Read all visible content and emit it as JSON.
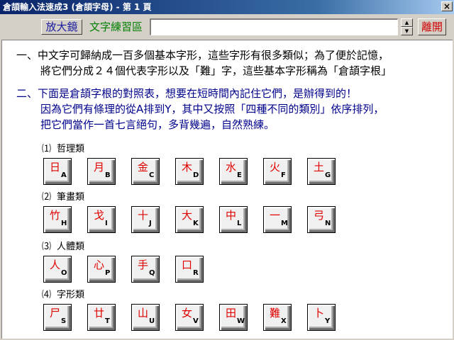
{
  "window": {
    "title": "倉頡輸入法速成3 (倉頡字母) - 第 1 頁",
    "close_label": "×"
  },
  "toolbar": {
    "magnifier_label": "放大鏡",
    "practice_label": "文字練習區",
    "practice_value": "",
    "spin_up": "▲",
    "spin_down": "▼",
    "exit_label": "離開"
  },
  "text": {
    "p1_line1": "一、中文字可歸納成一百多個基本字形，這些字形有很多類似；為了便於記憶，",
    "p1_line2": "將它們分成２４個代表字形以及「難」字，這些基本字形稱為「倉頡字根」",
    "p2_line1": "二、下面是倉頡字根的對照表，想要在短時間內記住它們，是辦得到的！",
    "p2_line2": "因為它們有條理的從A排到Y，其中又按照「四種不同的類別」依序排列，",
    "p2_line3": "把它們當作一首七言絕句，多背幾遍，自然熟練。"
  },
  "groups": [
    {
      "num": "⑴",
      "label": "哲理類",
      "keys": [
        {
          "char": "日",
          "letter": "A"
        },
        {
          "char": "月",
          "letter": "B"
        },
        {
          "char": "金",
          "letter": "C"
        },
        {
          "char": "木",
          "letter": "D"
        },
        {
          "char": "水",
          "letter": "E"
        },
        {
          "char": "火",
          "letter": "F"
        },
        {
          "char": "土",
          "letter": "G"
        }
      ]
    },
    {
      "num": "⑵",
      "label": "筆畫類",
      "keys": [
        {
          "char": "竹",
          "letter": "H"
        },
        {
          "char": "戈",
          "letter": "I"
        },
        {
          "char": "十",
          "letter": "J"
        },
        {
          "char": "大",
          "letter": "K"
        },
        {
          "char": "中",
          "letter": "L"
        },
        {
          "char": "一",
          "letter": "M"
        },
        {
          "char": "弓",
          "letter": "N"
        }
      ]
    },
    {
      "num": "⑶",
      "label": "人體類",
      "keys": [
        {
          "char": "人",
          "letter": "O"
        },
        {
          "char": "心",
          "letter": "P"
        },
        {
          "char": "手",
          "letter": "Q"
        },
        {
          "char": "口",
          "letter": "R"
        }
      ]
    },
    {
      "num": "⑷",
      "label": "字形類",
      "keys": [
        {
          "char": "尸",
          "letter": "S"
        },
        {
          "char": "廿",
          "letter": "T"
        },
        {
          "char": "山",
          "letter": "U"
        },
        {
          "char": "女",
          "letter": "V"
        },
        {
          "char": "田",
          "letter": "W"
        },
        {
          "char": "難",
          "letter": "X"
        },
        {
          "char": "卜",
          "letter": "Y"
        }
      ]
    }
  ]
}
